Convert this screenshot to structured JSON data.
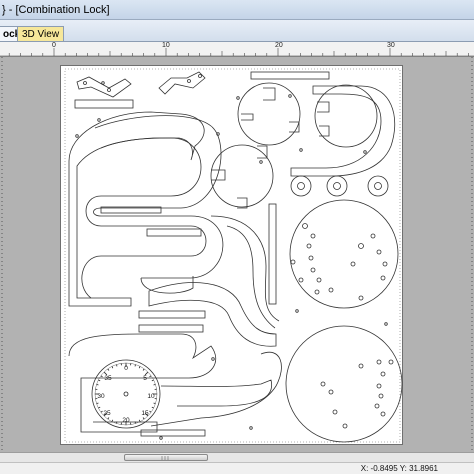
{
  "window": {
    "title": "} - [Combination Lock]"
  },
  "tabs": {
    "active_label": "ock",
    "view3d_label": "3D View"
  },
  "ruler": {
    "labels": [
      "0",
      "10",
      "20",
      "30"
    ]
  },
  "dial": {
    "numbers": [
      "0",
      "5",
      "10",
      "15",
      "20",
      "25",
      "30",
      "35"
    ]
  },
  "status": {
    "coords": "X: -0.8495 Y: 31.8961"
  }
}
